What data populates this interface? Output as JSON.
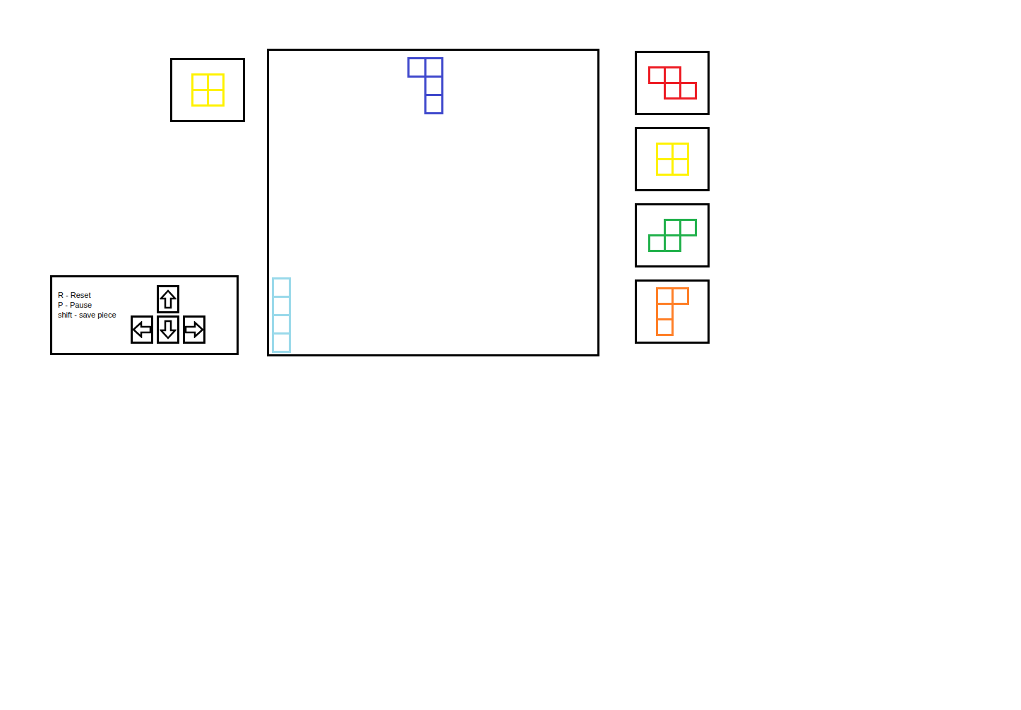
{
  "hold": {
    "piece": "O",
    "color": "#fff200",
    "cells": [
      [
        0,
        0
      ],
      [
        0,
        1
      ],
      [
        1,
        0
      ],
      [
        1,
        1
      ]
    ]
  },
  "board": {
    "pieces": [
      {
        "piece": "J",
        "color": "#3f48cc",
        "cells": [
          [
            0,
            8
          ],
          [
            0,
            9
          ],
          [
            1,
            9
          ],
          [
            2,
            9
          ]
        ]
      },
      {
        "piece": "I",
        "color": "#99d9ea",
        "cells": [
          [
            12,
            0
          ],
          [
            13,
            0
          ],
          [
            14,
            0
          ],
          [
            15,
            0
          ]
        ]
      }
    ]
  },
  "next": [
    {
      "piece": "Z",
      "color": "#ed1c24",
      "cells": [
        [
          0,
          0
        ],
        [
          0,
          1
        ],
        [
          1,
          1
        ],
        [
          1,
          2
        ]
      ]
    },
    {
      "piece": "O",
      "color": "#fff200",
      "cells": [
        [
          0,
          0
        ],
        [
          0,
          1
        ],
        [
          1,
          0
        ],
        [
          1,
          1
        ]
      ]
    },
    {
      "piece": "S",
      "color": "#22b14c",
      "cells": [
        [
          0,
          1
        ],
        [
          0,
          2
        ],
        [
          1,
          0
        ],
        [
          1,
          1
        ]
      ]
    },
    {
      "piece": "J",
      "color": "#ff7f27",
      "cells": [
        [
          0,
          0
        ],
        [
          0,
          1
        ],
        [
          1,
          0
        ],
        [
          2,
          0
        ]
      ]
    }
  ],
  "controls": {
    "shortcuts": [
      "R - Reset",
      "P - Pause",
      "shift - save piece"
    ]
  }
}
